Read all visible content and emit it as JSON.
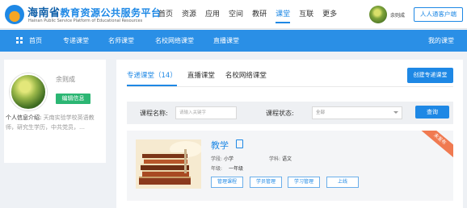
{
  "header": {
    "logo_cn_prefix": "海南省",
    "logo_cn_highlight": "教育资源公共服务平台",
    "logo_en": "Hainan Public Service Platform of Educational Resources",
    "nav": [
      "首页",
      "资源",
      "应用",
      "空间",
      "教研",
      "课堂",
      "互联",
      "更多"
    ],
    "active_nav": "课堂",
    "username": "余则成",
    "client_button": "人人通客户端"
  },
  "subnav": {
    "items": [
      "首页",
      "专递课堂",
      "名师课堂",
      "名校网络课堂",
      "直播课堂"
    ],
    "my_classroom": "我的课堂"
  },
  "profile": {
    "name": "余则成",
    "edit_button": "编辑信息",
    "intro_label": "个人信息介绍:",
    "intro_value": "天南实验学校英语教师，研究生学历，中共党员，…"
  },
  "main": {
    "tabs": [
      "专递课堂（14）",
      "直播课堂",
      "名校网络课堂"
    ],
    "active_tab": "专递课堂（14）",
    "create_button": "创建专递课堂",
    "filter": {
      "name_label": "课程名称:",
      "name_placeholder": "请输入关键字",
      "status_label": "课程状态:",
      "status_value": "全部",
      "query_button": "查询"
    },
    "course": {
      "title": "教学",
      "ribbon": "未发布",
      "stage_label": "学段:",
      "stage_value": "小学",
      "subject_label": "学科:",
      "subject_value": "语文",
      "grade_label": "年级:",
      "grade_value": "一年级",
      "actions": [
        "管理课程",
        "学员管理",
        "学习管理",
        "上线"
      ]
    }
  },
  "colors": {
    "brand_blue": "#1e88e5",
    "nav_blue": "#2a8fe6",
    "edit_green": "#2bb673",
    "ribbon_orange": "#f07a51"
  }
}
